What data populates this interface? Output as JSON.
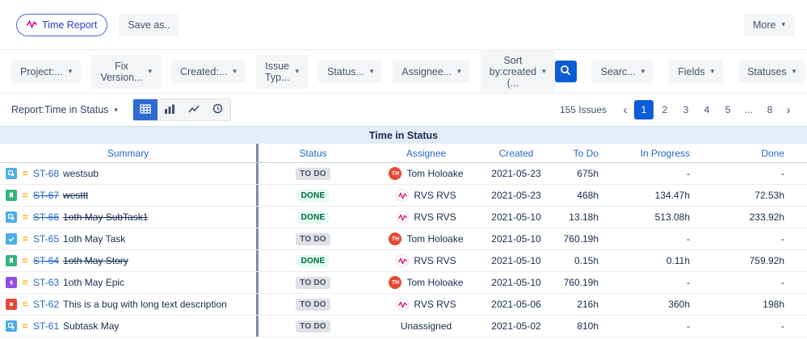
{
  "topbar": {
    "app_button": "Time Report",
    "save_as_label": "Save as..",
    "more_label": "More"
  },
  "filters": [
    "Project:...",
    "Fix Version...",
    "Created:...",
    "Issue Typ...",
    "Status...",
    "Assignee...",
    "Sort by:created (..."
  ],
  "toolbar_right": {
    "search_label": "Searc...",
    "fields_label": "Fields",
    "statuses_label": "Statuses"
  },
  "report_bar": {
    "report_label": "Report:Time in Status",
    "issues_count": "155 Issues",
    "pages": [
      "1",
      "2",
      "3",
      "4",
      "5",
      "...",
      "8"
    ],
    "active_page": "1"
  },
  "icons": {
    "chevron_down": "▾",
    "prev_page": "‹",
    "next_page": "›",
    "priority_medium": "=",
    "rvs_logo": "pink-wave",
    "search": "magnifier",
    "views": [
      "table-grid",
      "bar-chart",
      "line-chart",
      "clock"
    ]
  },
  "colors": {
    "accent_blue": "#0b5cd7",
    "link_blue": "#2368c4",
    "todo_badge_bg": "#dfe1e6",
    "todo_badge_text": "#42526e",
    "done_badge_bg": "#e3fcef",
    "done_badge_text": "#006644",
    "title_band_bg": "#e4ecf7",
    "priority_orange": "#ffab00"
  },
  "table": {
    "title": "Time in Status",
    "columns": [
      "Summary",
      "Status",
      "Assignee",
      "Created",
      "To Do",
      "In Progress",
      "Done"
    ],
    "rows": [
      {
        "key": "ST-68",
        "summary": "westsub",
        "type": "subtask",
        "resolved": false,
        "status": "TO DO",
        "status_type": "todo",
        "assignee": "Tom Holoake",
        "avatar": "th",
        "created": "2021-05-23",
        "todo": "675h",
        "in_progress": "-",
        "done": "-"
      },
      {
        "key": "ST-67",
        "summary": "westtt",
        "type": "story",
        "resolved": true,
        "status": "DONE",
        "status_type": "done",
        "assignee": "RVS RVS",
        "avatar": "rvs",
        "created": "2021-05-23",
        "todo": "468h",
        "in_progress": "134.47h",
        "done": "72.53h"
      },
      {
        "key": "ST-66",
        "summary": "1oth May SubTask1",
        "type": "subtask",
        "resolved": true,
        "status": "DONE",
        "status_type": "done",
        "assignee": "RVS RVS",
        "avatar": "rvs",
        "created": "2021-05-10",
        "todo": "13.18h",
        "in_progress": "513.08h",
        "done": "233.92h"
      },
      {
        "key": "ST-65",
        "summary": "1oth May Task",
        "type": "task",
        "resolved": false,
        "status": "TO DO",
        "status_type": "todo",
        "assignee": "Tom Holoake",
        "avatar": "th",
        "created": "2021-05-10",
        "todo": "760.19h",
        "in_progress": "-",
        "done": "-"
      },
      {
        "key": "ST-64",
        "summary": "1oth May Story",
        "type": "story",
        "resolved": true,
        "status": "DONE",
        "status_type": "done",
        "assignee": "RVS RVS",
        "avatar": "rvs",
        "created": "2021-05-10",
        "todo": "0.15h",
        "in_progress": "0.11h",
        "done": "759.92h"
      },
      {
        "key": "ST-63",
        "summary": "1oth May Epic",
        "type": "epic",
        "resolved": false,
        "status": "TO DO",
        "status_type": "todo",
        "assignee": "Tom Holoake",
        "avatar": "th",
        "created": "2021-05-10",
        "todo": "760.19h",
        "in_progress": "-",
        "done": "-"
      },
      {
        "key": "ST-62",
        "summary": "This is a bug with long text description",
        "type": "bug",
        "resolved": false,
        "status": "TO DO",
        "status_type": "todo",
        "assignee": "RVS RVS",
        "avatar": "rvs",
        "created": "2021-05-06",
        "todo": "216h",
        "in_progress": "360h",
        "done": "198h"
      },
      {
        "key": "ST-61",
        "summary": "Subtask May",
        "type": "subtask",
        "resolved": false,
        "status": "TO DO",
        "status_type": "todo",
        "assignee": "Unassigned",
        "avatar": null,
        "created": "2021-05-02",
        "todo": "810h",
        "in_progress": "-",
        "done": "-"
      }
    ]
  }
}
